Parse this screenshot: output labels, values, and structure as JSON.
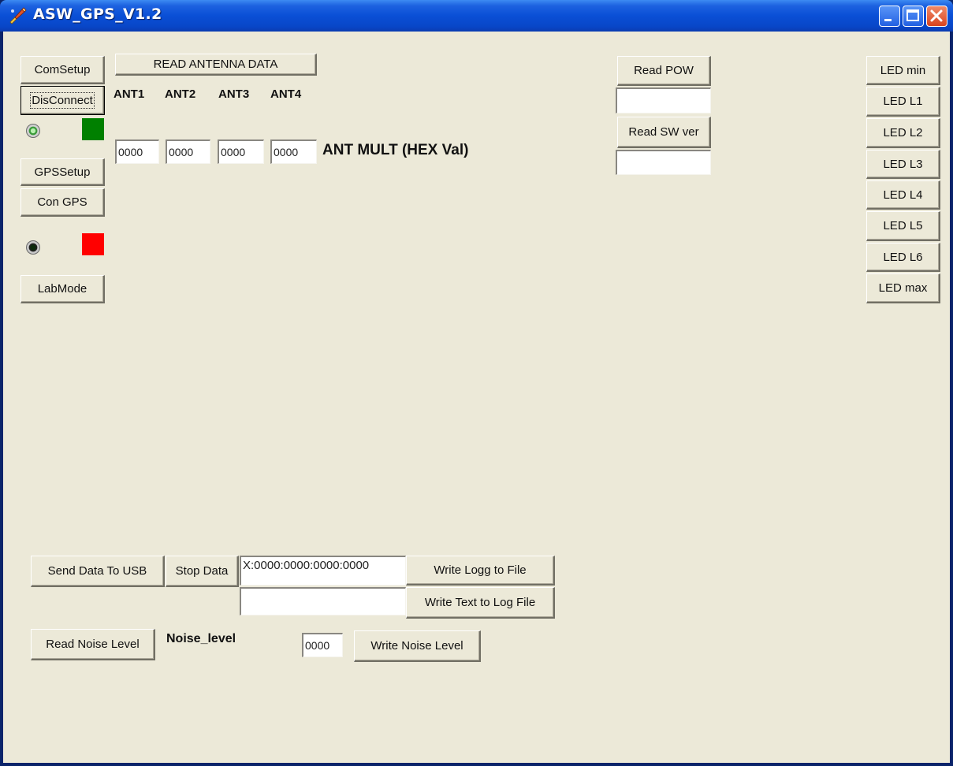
{
  "window": {
    "title": "ASW_GPS_V1.2"
  },
  "left_panel": {
    "com_setup": "ComSetup",
    "disconnect": "DisConnect",
    "gps_setup": "GPSSetup",
    "con_gps": "Con GPS",
    "lab_mode": "LabMode",
    "com_status_color": "#008000",
    "gps_status_color": "#ff0000"
  },
  "antenna": {
    "read_button": "READ ANTENNA DATA",
    "labels": [
      "ANT1",
      "ANT2",
      "ANT3",
      "ANT4"
    ],
    "values": [
      "0000",
      "0000",
      "0000",
      "0000"
    ],
    "mult_label": "ANT MULT (HEX Val)"
  },
  "center_right": {
    "read_pow": "Read POW",
    "pow_value": "",
    "read_sw_ver": "Read SW ver",
    "sw_ver_value": ""
  },
  "led_buttons": [
    "LED min",
    "LED L1",
    "LED L2",
    "LED L3",
    "LED L4",
    "LED L5",
    "LED L6",
    "LED max"
  ],
  "bottom": {
    "send_data": "Send Data To USB",
    "stop_data": "Stop Data",
    "data_field": "X:0000:0000:0000:0000",
    "write_logg": "Write Logg to File",
    "text_field": "",
    "write_text": "Write Text to Log File",
    "read_noise": "Read Noise Level",
    "noise_label": "Noise_level",
    "noise_value": "0000",
    "write_noise": "Write Noise Level"
  }
}
